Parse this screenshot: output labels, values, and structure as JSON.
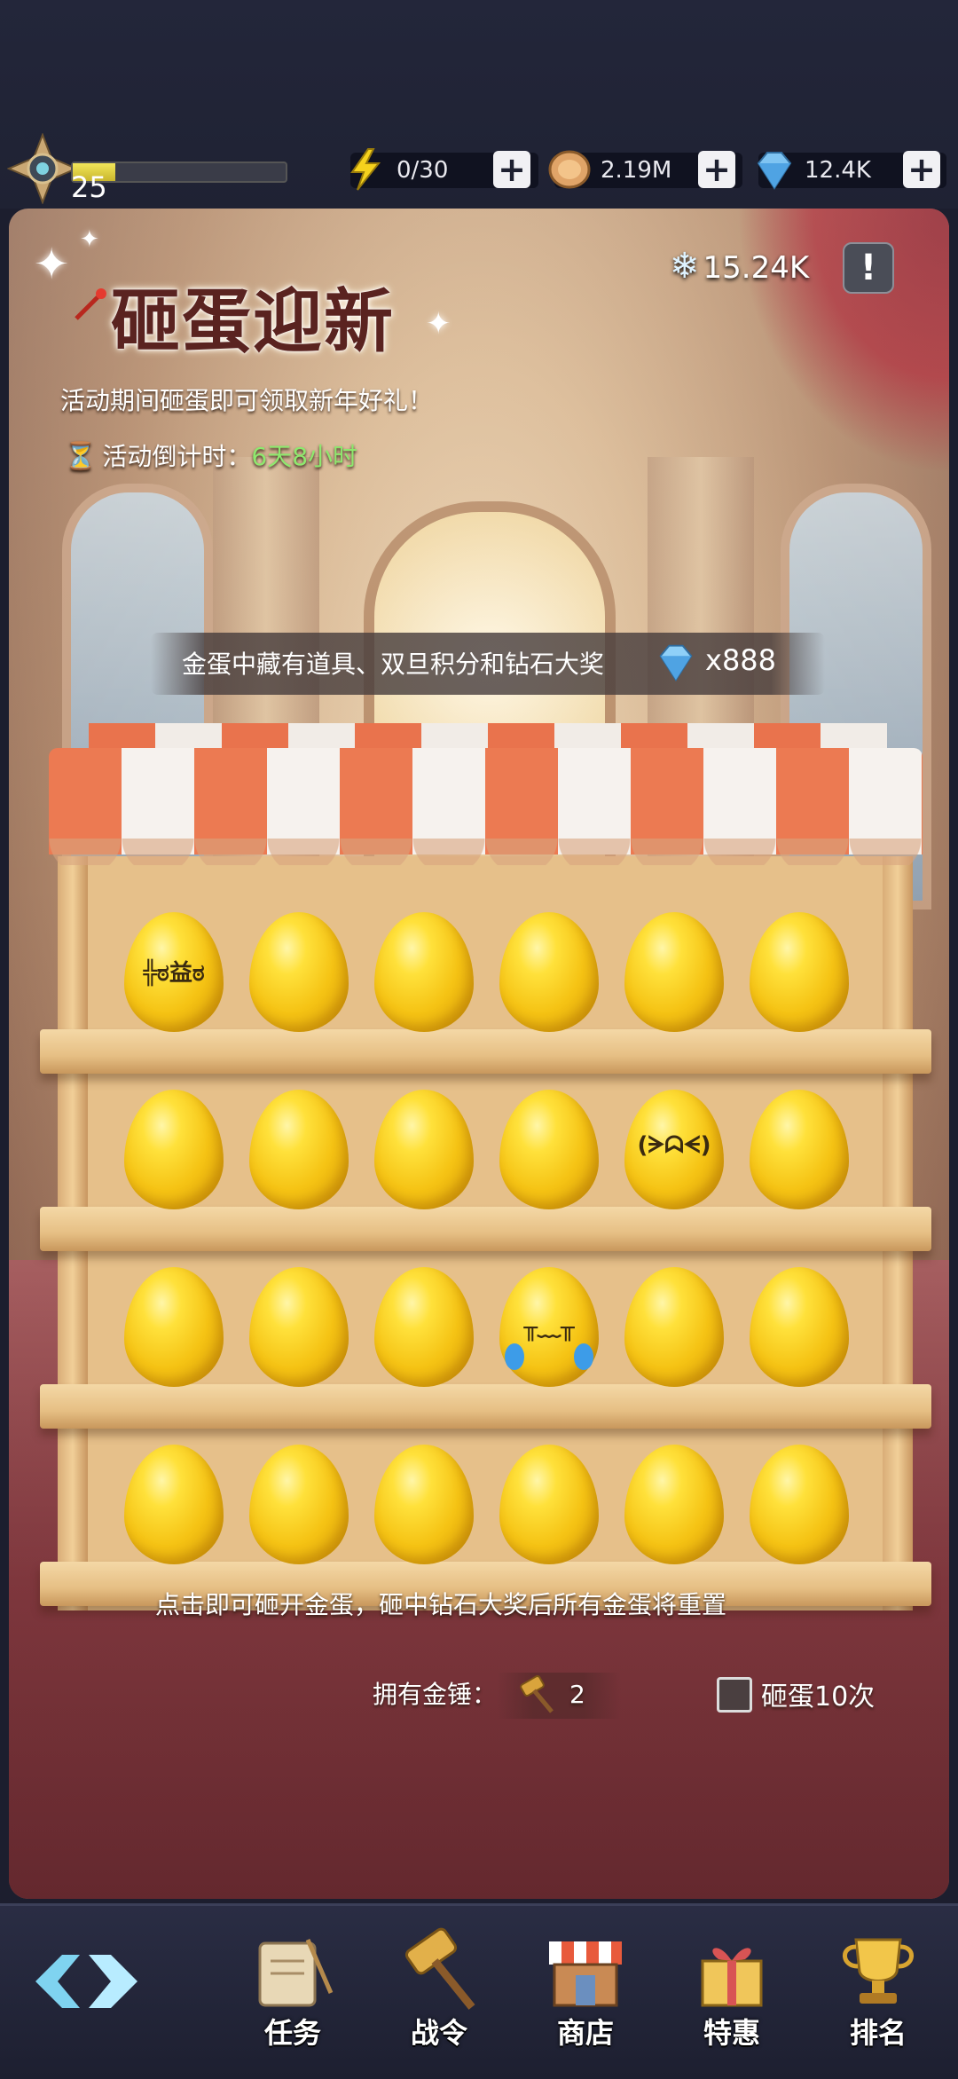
{
  "topbar": {
    "level": "25",
    "energy": "0/30",
    "coins": "2.19M",
    "gems": "12.4K"
  },
  "event": {
    "snow_count": "15.24K",
    "info_label": "!",
    "title": "砸蛋迎新",
    "description": "活动期间砸蛋即可领取新年好礼！",
    "countdown_label": "活动倒计时：",
    "countdown_value": "6天8小时",
    "banner_text": "金蛋中藏有道具、双旦积分和钻石大奖",
    "banner_prize": "x888",
    "hint": "点击即可砸开金蛋，砸中钻石大奖后所有金蛋将重置",
    "hammer_label": "拥有金锤：",
    "hammer_count": "2",
    "smash10_label": "砸蛋10次",
    "smash10_checked": false
  },
  "eggs": {
    "rows": 4,
    "cols": 6,
    "special": [
      {
        "row": 0,
        "col": 0,
        "face": "angry"
      },
      {
        "row": 1,
        "col": 4,
        "face": "worried"
      },
      {
        "row": 2,
        "col": 3,
        "face": "crying"
      }
    ]
  },
  "nav": {
    "items": [
      {
        "label": "任务",
        "icon": "scroll-icon"
      },
      {
        "label": "战令",
        "icon": "hammer-icon"
      },
      {
        "label": "商店",
        "icon": "shop-icon"
      },
      {
        "label": "特惠",
        "icon": "gift-icon"
      },
      {
        "label": "排名",
        "icon": "trophy-icon"
      }
    ]
  },
  "colors": {
    "accent_green": "#8ee86e",
    "egg_gold": "#f5c314",
    "awning_orange": "#ec7a52"
  }
}
